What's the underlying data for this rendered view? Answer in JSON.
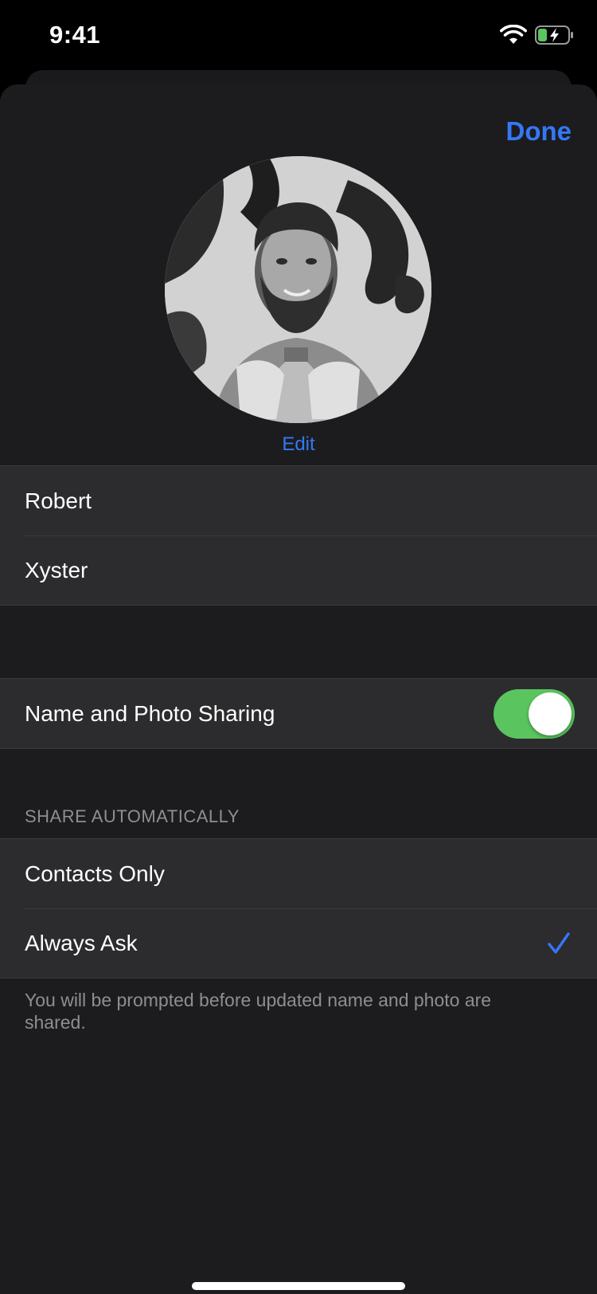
{
  "status_bar": {
    "time": "9:41",
    "icons": [
      "wifi-icon",
      "battery-charging-icon"
    ]
  },
  "header": {
    "done_label": "Done"
  },
  "profile": {
    "edit_label": "Edit"
  },
  "name_fields": {
    "first_name": "Robert",
    "last_name": "Xyster"
  },
  "sharing": {
    "label": "Name and Photo Sharing",
    "enabled": true
  },
  "share_automatically": {
    "header": "SHARE AUTOMATICALLY",
    "options": [
      {
        "label": "Contacts Only",
        "selected": false
      },
      {
        "label": "Always Ask",
        "selected": true
      }
    ],
    "footer": "You will be prompted before updated name and photo are shared."
  },
  "colors": {
    "accent": "#3478f6",
    "toggle_on": "#5ac55f",
    "background": "#1c1c1e",
    "cell": "#2c2c2e"
  }
}
